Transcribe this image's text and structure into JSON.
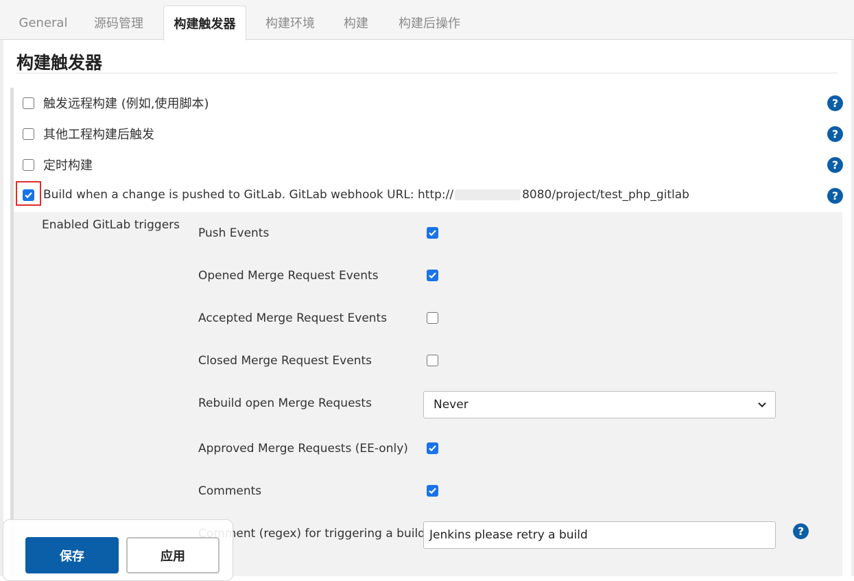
{
  "tabs": [
    {
      "label": "General",
      "active": false
    },
    {
      "label": "源码管理",
      "active": false
    },
    {
      "label": "构建触发器",
      "active": true
    },
    {
      "label": "构建环境",
      "active": false
    },
    {
      "label": "构建",
      "active": false
    },
    {
      "label": "构建后操作",
      "active": false
    }
  ],
  "section_title": "构建触发器",
  "triggers": [
    {
      "label": "触发远程构建 (例如,使用脚本)",
      "checked": false
    },
    {
      "label": "其他工程构建后触发",
      "checked": false
    },
    {
      "label": "定时构建",
      "checked": false
    },
    {
      "label_prefix": "Build when a change is pushed to GitLab. GitLab webhook URL: http://",
      "label_suffix": "8080/project/test_php_gitlab",
      "checked": true
    }
  ],
  "gitlab": {
    "panel_label": "Enabled GitLab triggers",
    "options": [
      {
        "label": "Push Events",
        "checked": true
      },
      {
        "label": "Opened Merge Request Events",
        "checked": true
      },
      {
        "label": "Accepted Merge Request Events",
        "checked": false
      },
      {
        "label": "Closed Merge Request Events",
        "checked": false
      },
      {
        "label": "Rebuild open Merge Requests",
        "type": "select",
        "value": "Never"
      },
      {
        "label": "Approved Merge Requests (EE-only)",
        "checked": true
      },
      {
        "label": "Comments",
        "checked": true
      },
      {
        "label": "Comment (regex) for triggering a build",
        "type": "text",
        "value": "Jenkins please retry a build"
      }
    ]
  },
  "buttons": {
    "save": "保存",
    "apply": "应用"
  },
  "icons": {
    "help": "question-circle-icon",
    "check": "checkmark-icon",
    "chevron": "chevron-down-icon"
  },
  "colors": {
    "accent": "#0b5ea8",
    "checkbox": "#1a73e8",
    "highlight": "#e02b2b"
  }
}
